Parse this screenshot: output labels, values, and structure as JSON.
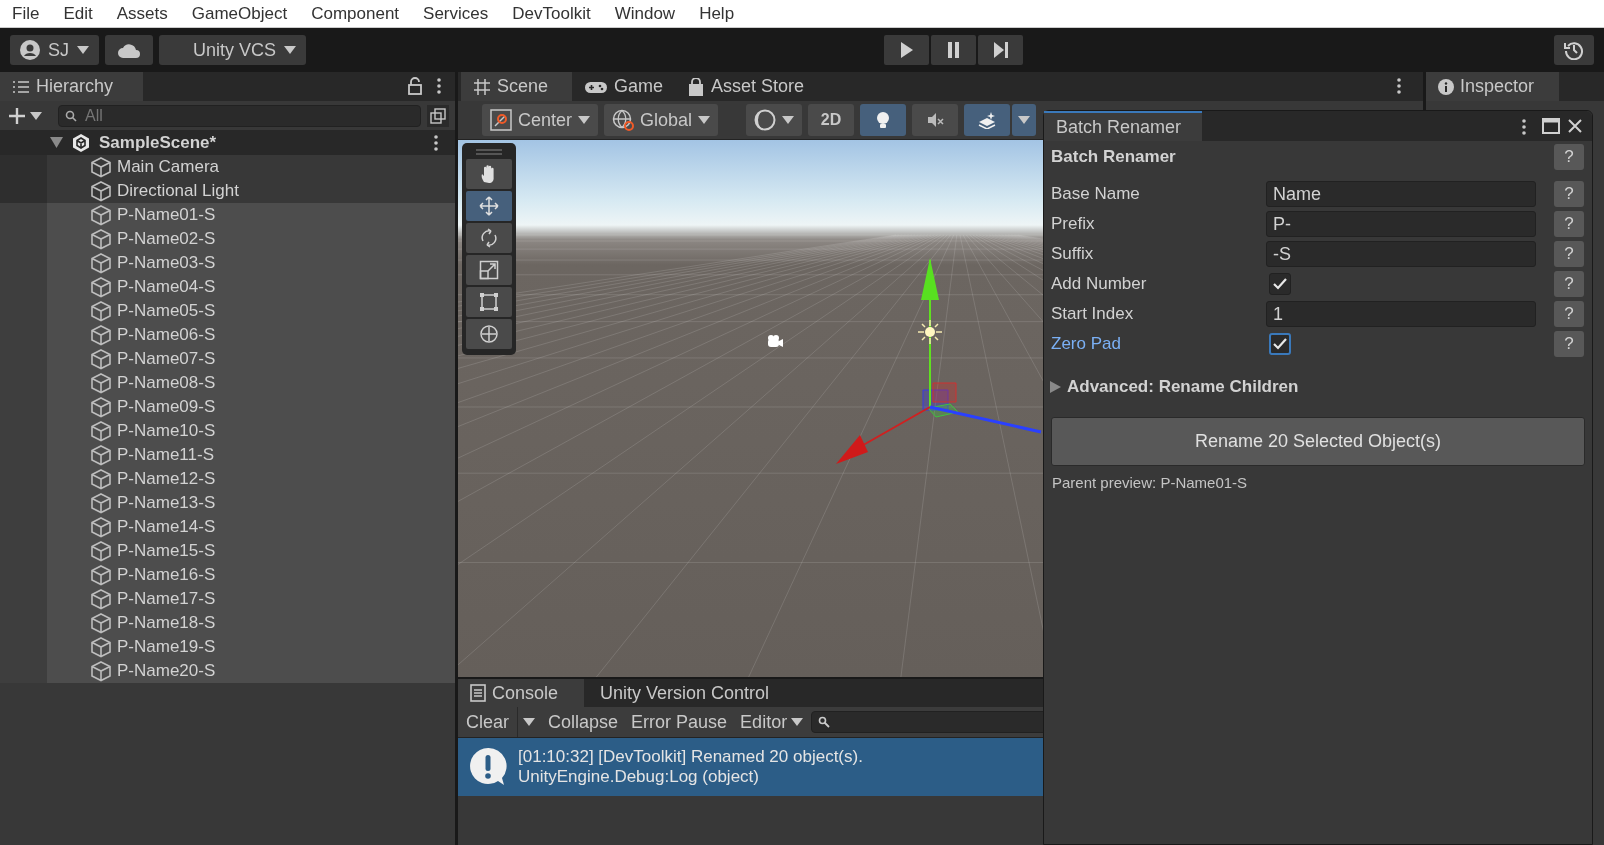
{
  "menu_bar": [
    "File",
    "Edit",
    "Assets",
    "GameObject",
    "Component",
    "Services",
    "DevToolkit",
    "Window",
    "Help"
  ],
  "main_toolbar": {
    "account": "SJ",
    "version_control": "Unity VCS"
  },
  "hierarchy": {
    "title": "Hierarchy",
    "search_placeholder": "All",
    "scene": {
      "name": "SampleScene*",
      "expanded": true,
      "children": [
        {
          "name": "Main Camera",
          "selected": false
        },
        {
          "name": "Directional Light",
          "selected": false
        },
        {
          "name": "P-Name01-S",
          "selected": true
        },
        {
          "name": "P-Name02-S",
          "selected": true
        },
        {
          "name": "P-Name03-S",
          "selected": true
        },
        {
          "name": "P-Name04-S",
          "selected": true
        },
        {
          "name": "P-Name05-S",
          "selected": true
        },
        {
          "name": "P-Name06-S",
          "selected": true
        },
        {
          "name": "P-Name07-S",
          "selected": true
        },
        {
          "name": "P-Name08-S",
          "selected": true
        },
        {
          "name": "P-Name09-S",
          "selected": true
        },
        {
          "name": "P-Name10-S",
          "selected": true
        },
        {
          "name": "P-Name11-S",
          "selected": true
        },
        {
          "name": "P-Name12-S",
          "selected": true
        },
        {
          "name": "P-Name13-S",
          "selected": true
        },
        {
          "name": "P-Name14-S",
          "selected": true
        },
        {
          "name": "P-Name15-S",
          "selected": true
        },
        {
          "name": "P-Name16-S",
          "selected": true
        },
        {
          "name": "P-Name17-S",
          "selected": true
        },
        {
          "name": "P-Name18-S",
          "selected": true
        },
        {
          "name": "P-Name19-S",
          "selected": true
        },
        {
          "name": "P-Name20-S",
          "selected": true
        }
      ]
    }
  },
  "scene_tabs": [
    {
      "kind": "scene",
      "label": "Scene",
      "selected": true
    },
    {
      "kind": "game",
      "label": "Game",
      "selected": false
    },
    {
      "kind": "store",
      "label": "Asset Store",
      "selected": false
    }
  ],
  "scene_toolbar": {
    "pivot": "Center",
    "space": "Global",
    "view_2d": "2D",
    "toggles": [
      {
        "kind": "lighting",
        "on": true
      },
      {
        "kind": "audio",
        "on": false
      },
      {
        "kind": "effects",
        "on": true
      }
    ]
  },
  "tools": [
    {
      "kind": "hand",
      "selected": false
    },
    {
      "kind": "move",
      "selected": true
    },
    {
      "kind": "rotate",
      "selected": false
    },
    {
      "kind": "scale",
      "selected": false
    },
    {
      "kind": "rect",
      "selected": false
    },
    {
      "kind": "transform",
      "selected": false
    }
  ],
  "console": {
    "tabs": [
      {
        "label": "Console",
        "selected": true
      },
      {
        "label": "Unity Version Control",
        "selected": false
      }
    ],
    "buttons": {
      "clear": "Clear",
      "collapse": "Collapse",
      "error_pause": "Error Pause",
      "editor": "Editor"
    },
    "messages": [
      {
        "text": "[01:10:32] [DevToolkit] Renamed 20 object(s).",
        "detail": "UnityEngine.Debug:Log (object)",
        "selected": true
      }
    ]
  },
  "inspector": {
    "title": "Inspector"
  },
  "batch_renamer": {
    "tab": "Batch Renamer",
    "heading": "Batch Renamer",
    "heading_help": "?",
    "fields": [
      {
        "kind": "text",
        "label": "Base Name",
        "value": "Name",
        "help": "?",
        "focused": false
      },
      {
        "kind": "text",
        "label": "Prefix",
        "value": "P-",
        "help": "?",
        "focused": false
      },
      {
        "kind": "text",
        "label": "Suffix",
        "value": "-S",
        "help": "?",
        "focused": false
      },
      {
        "kind": "checkbox",
        "label": "Add Number",
        "checked": true,
        "help": "?",
        "focused": false
      },
      {
        "kind": "text",
        "label": "Start Index",
        "value": "1",
        "help": "?",
        "focused": false
      },
      {
        "kind": "checkbox",
        "label": "Zero Pad",
        "checked": true,
        "help": "?",
        "focused": true
      }
    ],
    "foldout": {
      "label": "Advanced: Rename Children",
      "expanded": false
    },
    "button": "Rename 20 Selected Object(s)",
    "preview": "Parent preview: P-Name01-S"
  }
}
